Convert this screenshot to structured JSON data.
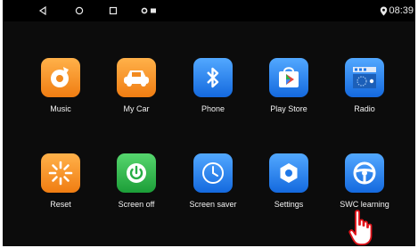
{
  "status_bar": {
    "nav_icons": [
      "back-icon",
      "home-icon",
      "recents-icon"
    ],
    "notification_icons": [
      "dot-notification-icon",
      "image-notification-icon"
    ],
    "location_icon": "location-icon",
    "time": "08:39"
  },
  "apps": [
    {
      "label": "Music",
      "icon": "music-icon",
      "color": "#f28a1e"
    },
    {
      "label": "My Car",
      "icon": "car-icon",
      "color": "#f28a1e"
    },
    {
      "label": "Phone",
      "icon": "bluetooth-icon",
      "color": "#1f78e8"
    },
    {
      "label": "Play Store",
      "icon": "play-store-icon",
      "color": "#1f78e8"
    },
    {
      "label": "Radio",
      "icon": "radio-icon",
      "color": "#1f78e8"
    },
    {
      "label": "Reset",
      "icon": "reset-icon",
      "color": "#f28a1e"
    },
    {
      "label": "Screen off",
      "icon": "power-icon",
      "color": "#26ad44"
    },
    {
      "label": "Screen saver",
      "icon": "clock-icon",
      "color": "#1f78e8"
    },
    {
      "label": "Settings",
      "icon": "settings-icon",
      "color": "#1f78e8"
    },
    {
      "label": "SWC learning",
      "icon": "steering-wheel-icon",
      "color": "#1f78e8"
    }
  ],
  "colors": {
    "background": "#0c0c0c",
    "status_bar": "#000000",
    "label_text": "#f2f2f2",
    "orange_accent": "#f28a1e",
    "blue_accent": "#1f78e8",
    "green_accent": "#26ad44"
  }
}
